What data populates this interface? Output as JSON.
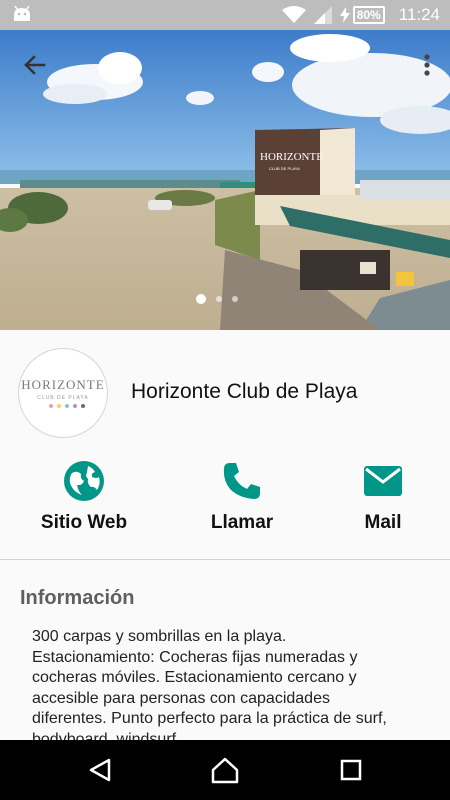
{
  "status_bar": {
    "battery": "80",
    "battery_unit": "%",
    "time": "11:24",
    "icons": [
      "android-icon",
      "wifi-icon",
      "signal-icon",
      "charging-icon",
      "battery-icon"
    ]
  },
  "hero": {
    "logo_text": "HORIZONTE",
    "logo_sub": "CLUB DE PLAYA",
    "icons": [
      "back-arrow-icon",
      "more-vert-icon"
    ],
    "carousel_pages": 3,
    "carousel_active": 0
  },
  "place": {
    "logo_text": "HORIZONTE",
    "logo_sub": "CLUB DE PLAYA",
    "title": "Horizonte Club de Playa"
  },
  "actions": [
    {
      "label": "Sitio Web",
      "icon": "globe-icon"
    },
    {
      "label": "Llamar",
      "icon": "phone-icon"
    },
    {
      "label": "Mail",
      "icon": "mail-icon"
    }
  ],
  "info": {
    "title": "Información",
    "text": "300 carpas y sombrillas en la playa. Estacionamiento: Cocheras fijas numeradas y cocheras móviles. Estacionamiento cercano y accesible para personas con capacidades diferentes.  Punto perfecto para la práctica de surf, bodyboard, windsurf."
  },
  "colors": {
    "accent": "#009688",
    "status_bar": "#bdbdbd",
    "nav_bar": "#000000",
    "background": "#fafafa"
  },
  "nav": {
    "icons": [
      "back-triangle-icon",
      "home-icon",
      "recents-icon"
    ]
  }
}
